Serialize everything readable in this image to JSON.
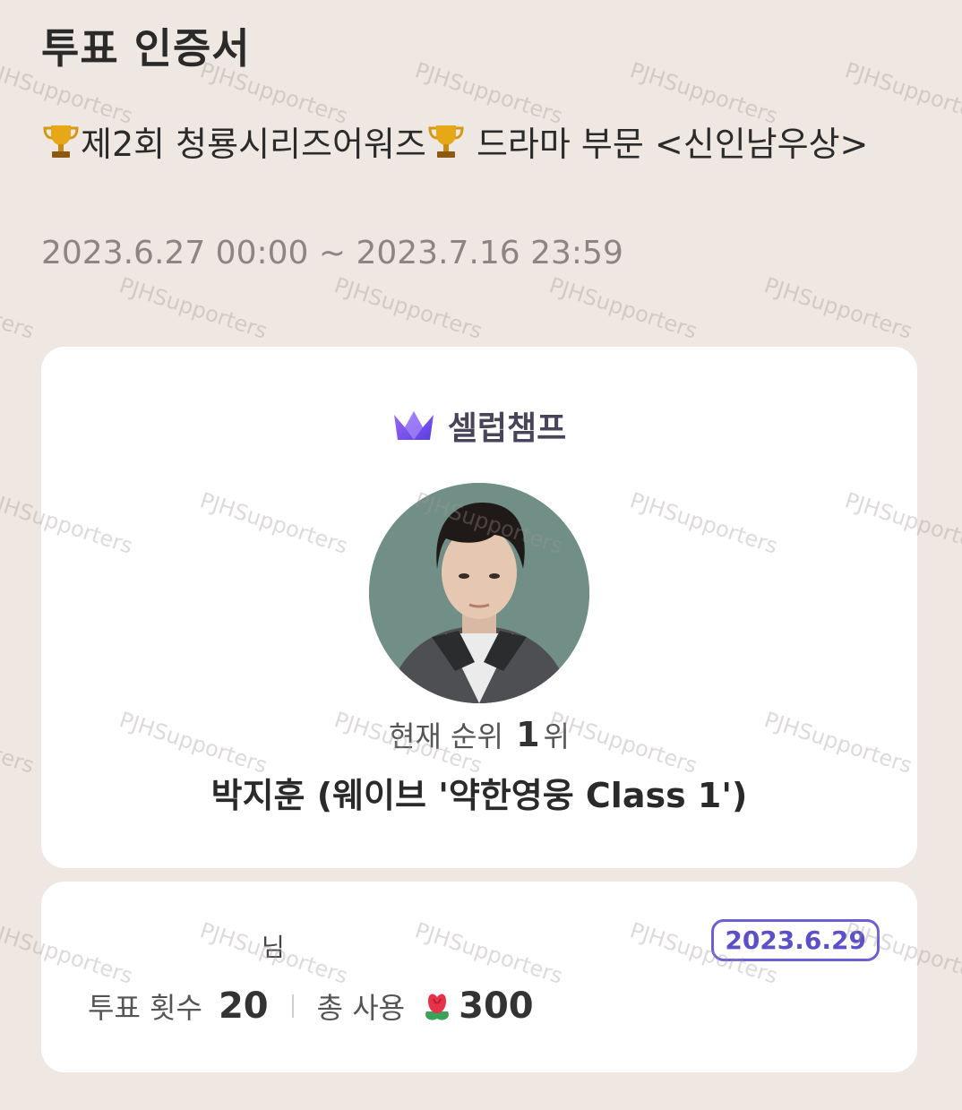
{
  "header": {
    "page_title": "투표 인증서",
    "vote_title": "제2회 청룡시리즈어워즈",
    "vote_title_rest": " 드라마 부문 <신인남우상>",
    "period": "2023.6.27 00:00 ~ 2023.7.16 23:59"
  },
  "main_card": {
    "brand": "셀럽챔프",
    "rank_prefix": "현재 순위",
    "rank_value": "1",
    "rank_suffix": "위",
    "candidate": "박지훈 (웨이브 '약한영웅 Class 1')"
  },
  "bottom_card": {
    "user_suffix": "님",
    "date": "2023.6.29",
    "votes_label": "투표 횟수",
    "votes_value": "20",
    "total_label": "총 사용",
    "total_value": "300"
  },
  "watermark": "PJHSupporters",
  "colors": {
    "background": "#efe7e1",
    "accent": "#6b5fd6",
    "brand_crown": "#7b5cf0"
  },
  "icons": [
    "trophy-icon",
    "crown-logo-icon",
    "flower-icon"
  ]
}
